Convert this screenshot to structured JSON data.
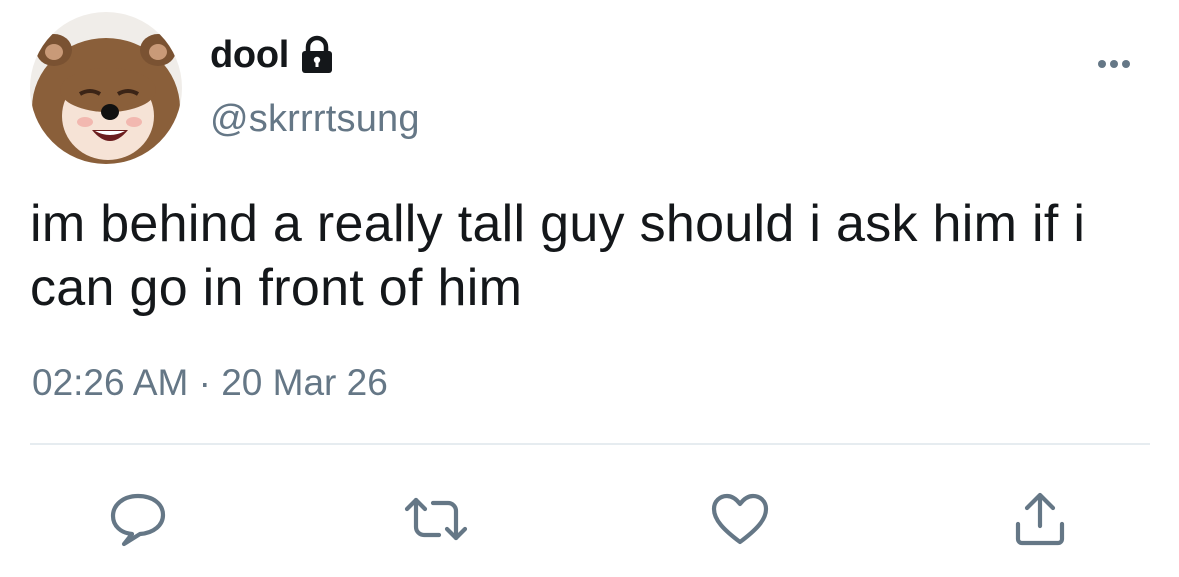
{
  "tweet": {
    "author": {
      "display_name": "dool",
      "handle": "@skrrrtsung",
      "protected_icon": "lock-icon",
      "avatar": "avatar-photo"
    },
    "menu_icon": "more-horizontal-icon",
    "text": "im behind a really tall guy should i ask him if i can go in front of him",
    "timestamp": "02:26 AM · 20 Mar 26",
    "actions": {
      "reply_icon": "comment-icon",
      "retweet_icon": "retweet-icon",
      "like_icon": "heart-icon",
      "share_icon": "share-icon"
    },
    "colors": {
      "primary_text": "#14171a",
      "secondary_text": "#657786",
      "divider": "#e6ecf0",
      "icon": "#657786"
    }
  }
}
